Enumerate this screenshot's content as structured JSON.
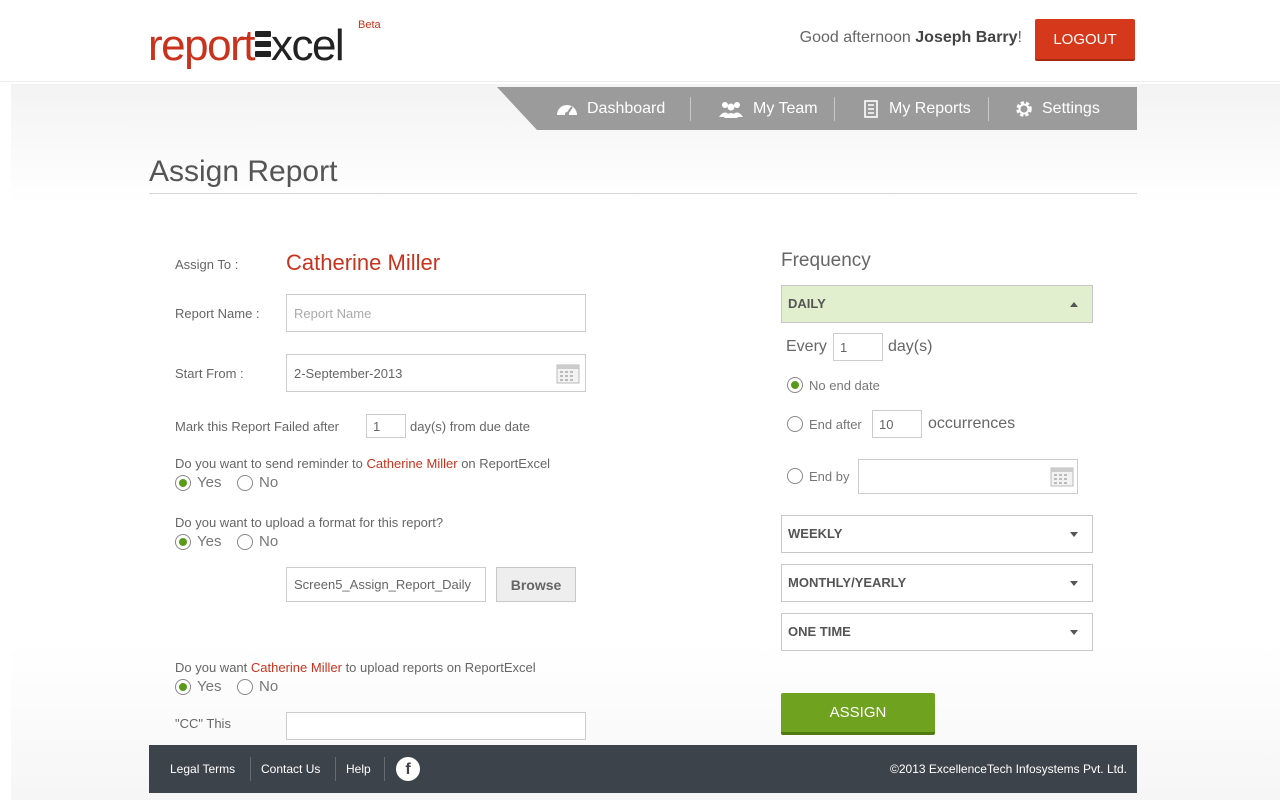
{
  "header": {
    "logo_part1": "report",
    "logo_part2": "xcel",
    "logo_beta": "Beta",
    "greeting": "Good afternoon",
    "user_name": "Joseph Barry",
    "greeting_suffix": "!",
    "logout_label": "LOGOUT"
  },
  "nav": {
    "items": [
      {
        "label": "Dashboard",
        "icon": "dashboard-icon"
      },
      {
        "label": "My Team",
        "icon": "team-icon"
      },
      {
        "label": "My Reports",
        "icon": "reports-icon"
      },
      {
        "label": "Settings",
        "icon": "gear-icon"
      }
    ]
  },
  "page": {
    "title": "Assign Report"
  },
  "form": {
    "assign_to_label": "Assign To :",
    "assign_to_value": "Catherine Miller",
    "report_name_label": "Report Name :",
    "report_name_placeholder": "Report Name",
    "start_from_label": "Start From :",
    "start_from_value": "2-September-2013",
    "mark_failed_prefix": "Mark this Report Failed after",
    "mark_failed_value": "1",
    "mark_failed_suffix": "day(s) from due date",
    "reminder_q_prefix": "Do you want to send reminder to",
    "reminder_q_name": "Catherine Miller",
    "reminder_q_suffix": "on ReportExcel",
    "upload_format_q": "Do you want to upload a format for this report?",
    "file_value": "Screen5_Assign_Report_Daily",
    "browse_label": "Browse",
    "upload_reports_q_prefix": "Do you want",
    "upload_reports_q_name": "Catherine Miller",
    "upload_reports_q_suffix": "to upload reports on ReportExcel",
    "cc_label": "\"CC\" This",
    "yes_label": "Yes",
    "no_label": "No"
  },
  "frequency": {
    "title": "Frequency",
    "daily_label": "DAILY",
    "every_label": "Every",
    "every_value": "1",
    "days_label": "day(s)",
    "no_end_label": "No end date",
    "end_after_label": "End after",
    "end_after_value": "10",
    "occurrences_label": "occurrences",
    "end_by_label": "End by",
    "weekly_label": "WEEKLY",
    "monthly_label": "MONTHLY/YEARLY",
    "one_time_label": "ONE TIME",
    "assign_label": "ASSIGN"
  },
  "footer": {
    "links": [
      "Legal Terms",
      "Contact Us",
      "Help"
    ],
    "facebook_glyph": "f",
    "copyright": "©2013 ExcellenceTech Infosystems Pvt. Ltd."
  },
  "colors": {
    "brand_red": "#c9331e",
    "logout_red": "#d5381b",
    "assign_green": "#6ea21f",
    "nav_gray": "#9b9b9b",
    "footer_dark": "#3d434a",
    "active_dropdown": "#e2efcf"
  }
}
